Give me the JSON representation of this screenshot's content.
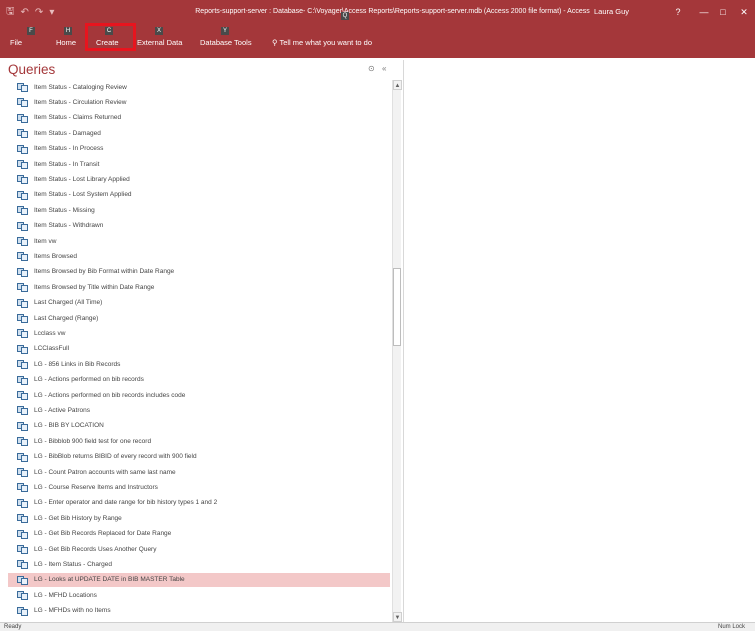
{
  "window": {
    "title": "Reports-support-server : Database- C:\\Voyager\\Access Reports\\Reports-support-server.mdb (Access 2000 file format)  -  Access",
    "user": "Laura Guy",
    "help": "?",
    "minimize": "—",
    "maximize": "□",
    "close": "✕"
  },
  "qat": {
    "save": "🖫",
    "undo": "↶",
    "redo": "↷",
    "customize": "▾"
  },
  "ribbon": {
    "tabs": [
      {
        "label": "File",
        "keytip": "F"
      },
      {
        "label": "Home",
        "keytip": "H"
      },
      {
        "label": "Create",
        "keytip": "C"
      },
      {
        "label": "External Data",
        "keytip": "X"
      },
      {
        "label": "Database Tools",
        "keytip": "Y"
      }
    ],
    "tell_me": {
      "icon": "lightbulb-icon",
      "label": "Tell me what you want to do",
      "keytip": "Q"
    }
  },
  "nav_pane": {
    "title": "Queries",
    "items": [
      "Item Status - Cataloging Review",
      "Item Status - Circulation Review",
      "Item Status - Claims Returned",
      "Item Status - Damaged",
      "Item Status - In Process",
      "Item Status - In Transit",
      "Item Status - Lost Library Applied",
      "Item Status - Lost System Applied",
      "Item Status - Missing",
      "Item Status - Withdrawn",
      "Item vw",
      "Items Browsed",
      "Items Browsed by Bib Format within Date Range",
      "Items Browsed by Title within Date Range",
      "Last Charged (All Time)",
      "Last Charged (Range)",
      "Lcclass vw",
      "LCClassFull",
      "LG - 856 Links in Bib Records",
      "LG - Actions performed on bib records",
      "LG - Actions performed on bib records includes code",
      "LG - Active Patrons",
      "LG - BIB BY LOCATION",
      "LG - Bibblob 900 field test for one record",
      "LG - BibBlob returns BIBID of every record with 900 field",
      "LG - Count Patron accounts with same last name",
      "LG - Course Reserve Items and Instructors",
      "LG - Enter operator and date range for bib history types 1 and 2",
      "LG - Get Bib History by Range",
      "LG - Get Bib Records Replaced for Date Range",
      "LG - Get Bib Records Uses Another Query",
      "LG - Item Status - Charged",
      "LG - Looks at UPDATE DATE in BIB MASTER Table",
      "LG - MFHD Locations",
      "LG - MFHDs with no Items"
    ],
    "selected_item": "LG - Looks at UPDATE DATE in BIB MASTER Table"
  },
  "status_bar": {
    "left": "Ready",
    "right": "Num Lock"
  },
  "colors": {
    "accent": "#a4373a",
    "selection": "#f3c8c8",
    "highlight_box": "#e8141e"
  }
}
